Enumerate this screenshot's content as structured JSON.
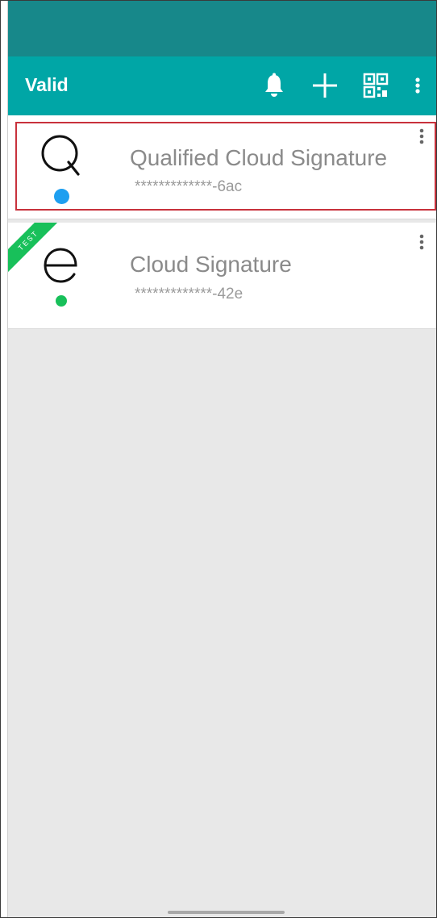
{
  "app_bar": {
    "title": "Valid",
    "actions": [
      {
        "icon": "bell-icon"
      },
      {
        "icon": "plus-icon"
      },
      {
        "icon": "qr-code-icon"
      },
      {
        "icon": "more-vertical-icon"
      }
    ]
  },
  "certificates": [
    {
      "logo_letter": "Q",
      "title": "Qualified Cloud Signature",
      "id_masked": "*************-6ac",
      "status_dot_color": "#1e9ff0",
      "badge": "",
      "selected": true
    },
    {
      "logo_letter": "e",
      "title": "Cloud Signature",
      "id_masked": "*************-42e",
      "status_dot_color": "#18c05a",
      "badge": "TEST",
      "selected": false
    }
  ],
  "colors": {
    "status_bar": "#17888a",
    "app_bar": "#00a6a6",
    "selection_border": "#c8323c",
    "test_ribbon": "#18c05a"
  }
}
